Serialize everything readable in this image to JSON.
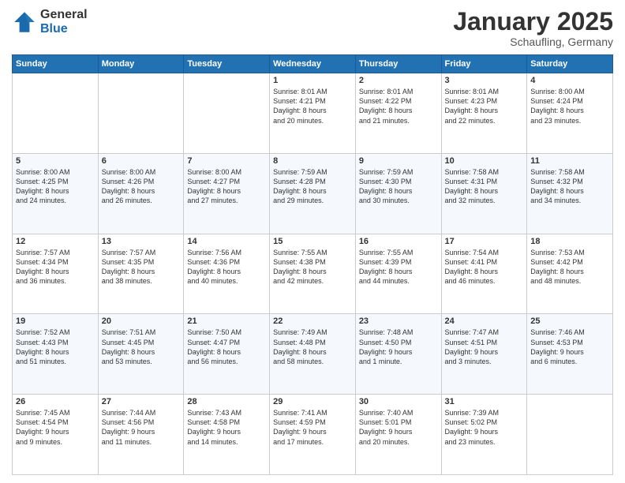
{
  "header": {
    "logo_general": "General",
    "logo_blue": "Blue",
    "month_title": "January 2025",
    "location": "Schaufling, Germany"
  },
  "weekdays": [
    "Sunday",
    "Monday",
    "Tuesday",
    "Wednesday",
    "Thursday",
    "Friday",
    "Saturday"
  ],
  "weeks": [
    [
      {
        "day": "",
        "text": ""
      },
      {
        "day": "",
        "text": ""
      },
      {
        "day": "",
        "text": ""
      },
      {
        "day": "1",
        "text": "Sunrise: 8:01 AM\nSunset: 4:21 PM\nDaylight: 8 hours\nand 20 minutes."
      },
      {
        "day": "2",
        "text": "Sunrise: 8:01 AM\nSunset: 4:22 PM\nDaylight: 8 hours\nand 21 minutes."
      },
      {
        "day": "3",
        "text": "Sunrise: 8:01 AM\nSunset: 4:23 PM\nDaylight: 8 hours\nand 22 minutes."
      },
      {
        "day": "4",
        "text": "Sunrise: 8:00 AM\nSunset: 4:24 PM\nDaylight: 8 hours\nand 23 minutes."
      }
    ],
    [
      {
        "day": "5",
        "text": "Sunrise: 8:00 AM\nSunset: 4:25 PM\nDaylight: 8 hours\nand 24 minutes."
      },
      {
        "day": "6",
        "text": "Sunrise: 8:00 AM\nSunset: 4:26 PM\nDaylight: 8 hours\nand 26 minutes."
      },
      {
        "day": "7",
        "text": "Sunrise: 8:00 AM\nSunset: 4:27 PM\nDaylight: 8 hours\nand 27 minutes."
      },
      {
        "day": "8",
        "text": "Sunrise: 7:59 AM\nSunset: 4:28 PM\nDaylight: 8 hours\nand 29 minutes."
      },
      {
        "day": "9",
        "text": "Sunrise: 7:59 AM\nSunset: 4:30 PM\nDaylight: 8 hours\nand 30 minutes."
      },
      {
        "day": "10",
        "text": "Sunrise: 7:58 AM\nSunset: 4:31 PM\nDaylight: 8 hours\nand 32 minutes."
      },
      {
        "day": "11",
        "text": "Sunrise: 7:58 AM\nSunset: 4:32 PM\nDaylight: 8 hours\nand 34 minutes."
      }
    ],
    [
      {
        "day": "12",
        "text": "Sunrise: 7:57 AM\nSunset: 4:34 PM\nDaylight: 8 hours\nand 36 minutes."
      },
      {
        "day": "13",
        "text": "Sunrise: 7:57 AM\nSunset: 4:35 PM\nDaylight: 8 hours\nand 38 minutes."
      },
      {
        "day": "14",
        "text": "Sunrise: 7:56 AM\nSunset: 4:36 PM\nDaylight: 8 hours\nand 40 minutes."
      },
      {
        "day": "15",
        "text": "Sunrise: 7:55 AM\nSunset: 4:38 PM\nDaylight: 8 hours\nand 42 minutes."
      },
      {
        "day": "16",
        "text": "Sunrise: 7:55 AM\nSunset: 4:39 PM\nDaylight: 8 hours\nand 44 minutes."
      },
      {
        "day": "17",
        "text": "Sunrise: 7:54 AM\nSunset: 4:41 PM\nDaylight: 8 hours\nand 46 minutes."
      },
      {
        "day": "18",
        "text": "Sunrise: 7:53 AM\nSunset: 4:42 PM\nDaylight: 8 hours\nand 48 minutes."
      }
    ],
    [
      {
        "day": "19",
        "text": "Sunrise: 7:52 AM\nSunset: 4:43 PM\nDaylight: 8 hours\nand 51 minutes."
      },
      {
        "day": "20",
        "text": "Sunrise: 7:51 AM\nSunset: 4:45 PM\nDaylight: 8 hours\nand 53 minutes."
      },
      {
        "day": "21",
        "text": "Sunrise: 7:50 AM\nSunset: 4:47 PM\nDaylight: 8 hours\nand 56 minutes."
      },
      {
        "day": "22",
        "text": "Sunrise: 7:49 AM\nSunset: 4:48 PM\nDaylight: 8 hours\nand 58 minutes."
      },
      {
        "day": "23",
        "text": "Sunrise: 7:48 AM\nSunset: 4:50 PM\nDaylight: 9 hours\nand 1 minute."
      },
      {
        "day": "24",
        "text": "Sunrise: 7:47 AM\nSunset: 4:51 PM\nDaylight: 9 hours\nand 3 minutes."
      },
      {
        "day": "25",
        "text": "Sunrise: 7:46 AM\nSunset: 4:53 PM\nDaylight: 9 hours\nand 6 minutes."
      }
    ],
    [
      {
        "day": "26",
        "text": "Sunrise: 7:45 AM\nSunset: 4:54 PM\nDaylight: 9 hours\nand 9 minutes."
      },
      {
        "day": "27",
        "text": "Sunrise: 7:44 AM\nSunset: 4:56 PM\nDaylight: 9 hours\nand 11 minutes."
      },
      {
        "day": "28",
        "text": "Sunrise: 7:43 AM\nSunset: 4:58 PM\nDaylight: 9 hours\nand 14 minutes."
      },
      {
        "day": "29",
        "text": "Sunrise: 7:41 AM\nSunset: 4:59 PM\nDaylight: 9 hours\nand 17 minutes."
      },
      {
        "day": "30",
        "text": "Sunrise: 7:40 AM\nSunset: 5:01 PM\nDaylight: 9 hours\nand 20 minutes."
      },
      {
        "day": "31",
        "text": "Sunrise: 7:39 AM\nSunset: 5:02 PM\nDaylight: 9 hours\nand 23 minutes."
      },
      {
        "day": "",
        "text": ""
      }
    ]
  ]
}
